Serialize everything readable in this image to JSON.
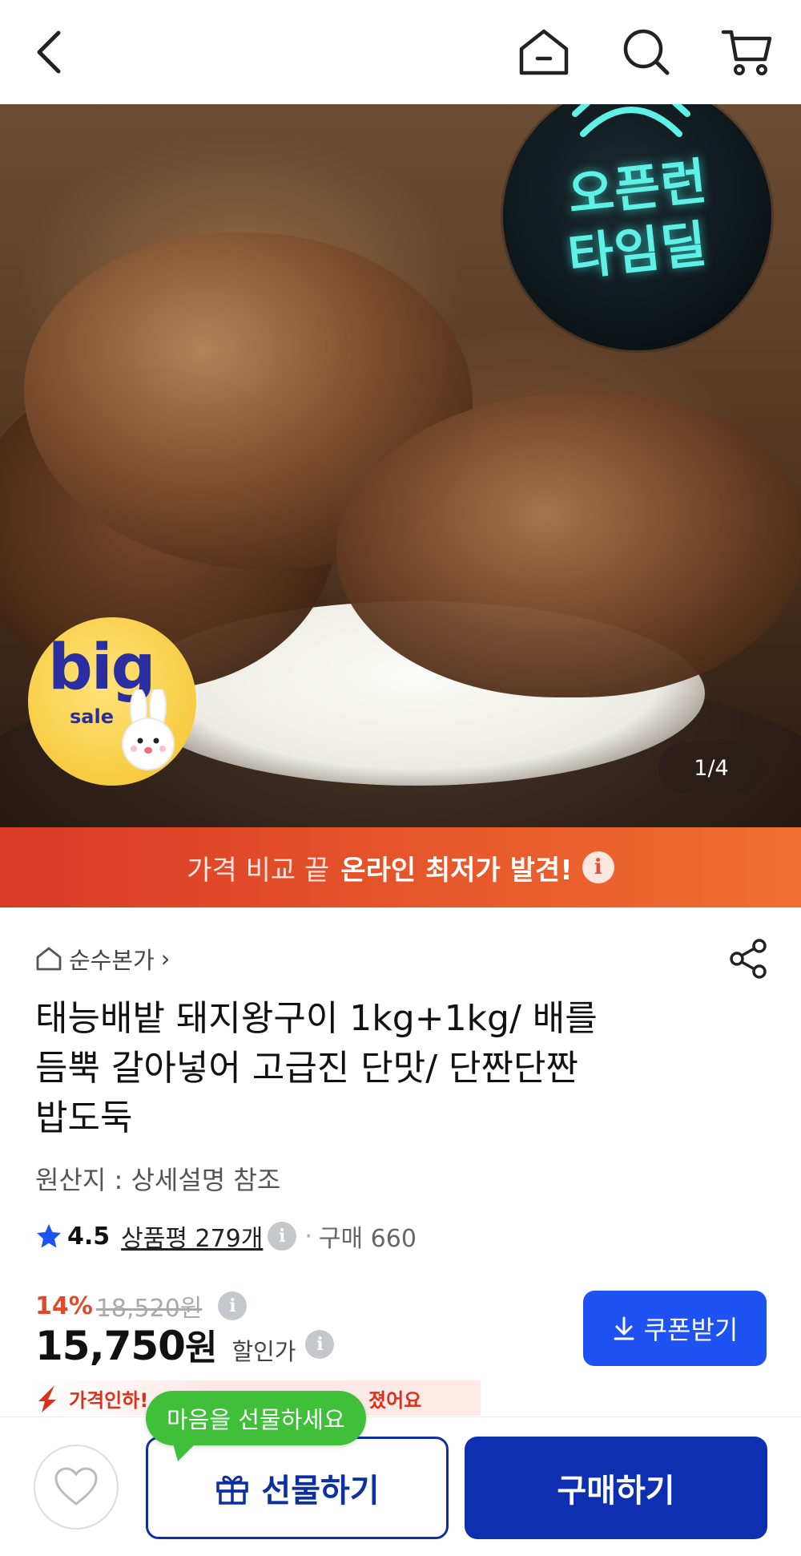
{
  "nav": {
    "back_icon": "chevron-left-icon",
    "home_icon": "home-icon",
    "search_icon": "search-icon",
    "cart_icon": "cart-icon"
  },
  "hero": {
    "badge_top_line1": "오픈런",
    "badge_top_line2": "타임딜",
    "badge_bottom_big": "big",
    "badge_bottom_sale": "sale",
    "image_counter": "1/4"
  },
  "banner": {
    "text_light": "가격 비교 끝",
    "text_bold": "온라인 최저가 발견!",
    "info_icon": "i"
  },
  "product": {
    "store_name": "순수본가",
    "store_chevron": "›",
    "title_line1": "태능배밭 돼지왕구이 1kg+1kg/ 배를",
    "title_line2": "듬뿍 갈아넣어 고급진 단맛/ 단짠단짠",
    "title_line3": "밥도둑",
    "origin": "원산지 : 상세설명 참조",
    "rating_score": "4.5",
    "reviews": "상품평 279개",
    "purchases": "구매 660",
    "info_icon": "i",
    "dot": "·"
  },
  "price": {
    "discount_pct": "14%",
    "original_price": "18,520원",
    "sale_price_num": "15,750",
    "sale_price_won": "원",
    "sale_label": "할인가",
    "coupon_label": "쿠폰받기",
    "price_drop_label": "가격인하!",
    "price_drop_tail": "졌어요"
  },
  "bottom": {
    "tooltip": "마음을 선물하세요",
    "gift_label": "선물하기",
    "buy_label": "구매하기"
  },
  "colors": {
    "accent_blue": "#1f52f2",
    "buy_blue": "#0e2fb0",
    "banner_red": "#d93a25",
    "tooltip_green": "#3fbf3a",
    "discount_red": "#e04a2a"
  }
}
